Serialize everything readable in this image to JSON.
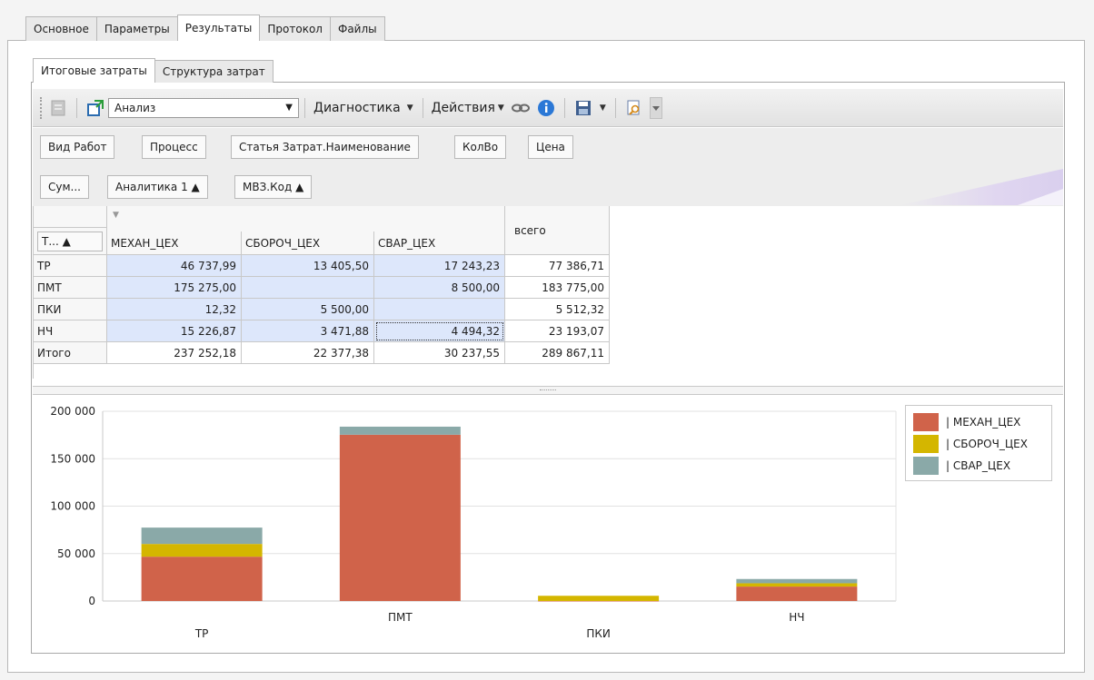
{
  "main_tabs": [
    {
      "label": "Основное",
      "active": false
    },
    {
      "label": "Параметры",
      "active": false
    },
    {
      "label": "Результаты",
      "active": true
    },
    {
      "label": "Протокол",
      "active": false
    },
    {
      "label": "Файлы",
      "active": false
    }
  ],
  "sub_tabs": [
    {
      "label": "Итоговые затраты",
      "active": true
    },
    {
      "label": "Структура затрат",
      "active": false
    }
  ],
  "toolbar": {
    "combo_value": "Анализ",
    "diagnostics_label": "Диагностика",
    "actions_label": "Действия"
  },
  "filter_fields": [
    "Вид Работ",
    "Процесс",
    "Статья Затрат.Наименование",
    "КолВо",
    "Цена"
  ],
  "data_field": "Сум...",
  "column_fields": [
    "Аналитика 1 ▲",
    "МВЗ.Код ▲"
  ],
  "row_field": "Т... ▲",
  "grid": {
    "columns": [
      "МЕХАН_ЦЕХ",
      "СБОРОЧ_ЦЕХ",
      "СВАР_ЦЕХ"
    ],
    "total_label": "всего",
    "rows": [
      {
        "label": "ТР",
        "values": [
          "46 737,99",
          "13 405,50",
          "17 243,23"
        ],
        "total": "77 386,71"
      },
      {
        "label": "ПМТ",
        "values": [
          "175 275,00",
          "",
          "8 500,00"
        ],
        "total": "183 775,00"
      },
      {
        "label": "ПКИ",
        "values": [
          "12,32",
          "5 500,00",
          ""
        ],
        "total": "5 512,32"
      },
      {
        "label": "НЧ",
        "values": [
          "15 226,87",
          "3 471,88",
          "4 494,32"
        ],
        "total": "23 193,07"
      },
      {
        "label": "Итого",
        "values": [
          "237 252,18",
          "22 377,38",
          "30 237,55"
        ],
        "total": "289 867,11"
      }
    ]
  },
  "chart_data": {
    "type": "bar",
    "stacked": true,
    "categories": [
      "ТР",
      "ПМТ",
      "ПКИ",
      "НЧ"
    ],
    "series": [
      {
        "name": "| МЕХАН_ЦЕХ",
        "color": "#d0634a",
        "values": [
          46737.99,
          175275.0,
          12.32,
          15226.87
        ]
      },
      {
        "name": "| СБОРОЧ_ЦЕХ",
        "color": "#d4b600",
        "values": [
          13405.5,
          0,
          5500.0,
          3471.88
        ]
      },
      {
        "name": "| СВАР_ЦЕХ",
        "color": "#8aa9a8",
        "values": [
          17243.23,
          8500.0,
          0,
          4494.32
        ]
      }
    ],
    "yticks": [
      "0",
      "50 000",
      "100 000",
      "150 000",
      "200 000"
    ],
    "ylim": [
      0,
      200000
    ],
    "grid": true,
    "legend": "top-right"
  }
}
